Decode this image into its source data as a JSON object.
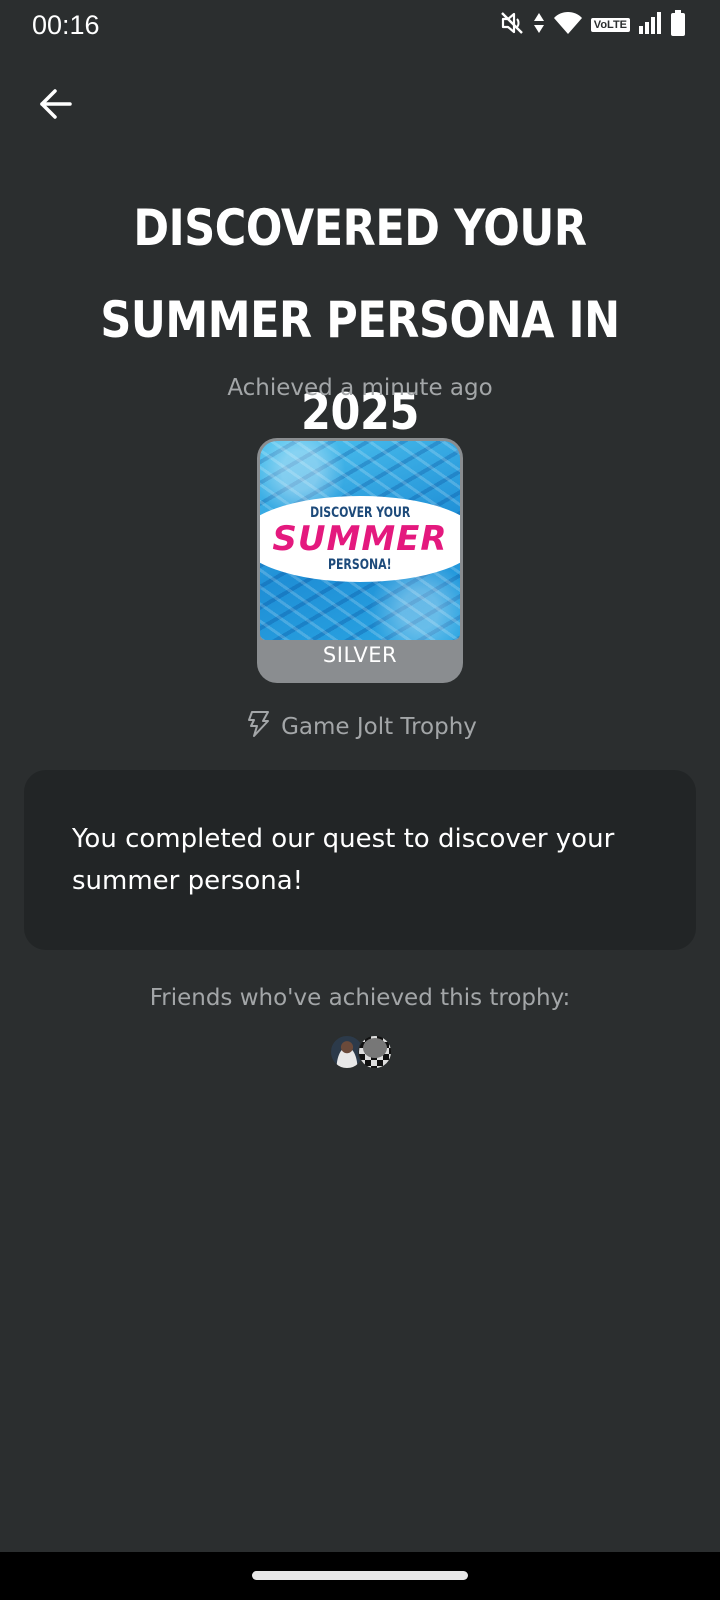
{
  "status_bar": {
    "time": "00:16",
    "volte_label": "VoLTE",
    "icons": [
      "mute-icon",
      "data-arrows-icon",
      "wifi-icon",
      "volte-badge",
      "signal-icon",
      "battery-icon"
    ]
  },
  "header": {
    "back_icon": "arrow-left-icon"
  },
  "trophy": {
    "title": "DISCOVERED YOUR SUMMER PERSONA IN 2025",
    "achieved_time": "Achieved a minute ago",
    "image_text_top": "DISCOVER YOUR",
    "image_text_main": "SUMMER",
    "image_text_bottom": "PERSONA!",
    "tier": "SILVER",
    "source_icon": "game-jolt-bolt-icon",
    "source": "Game Jolt Trophy",
    "description": "You completed our quest to discover your summer persona!"
  },
  "friends": {
    "label": "Friends who've achieved this trophy:",
    "avatars": [
      "friend-avatar-1",
      "friend-avatar-2"
    ]
  },
  "colors": {
    "background": "#2b2e2f",
    "card": "#222526",
    "muted_text": "#a3a6a8",
    "tier_silver": "#8a8d90",
    "summer_pink": "#e4197e",
    "pool_blue": "#2aa6e3"
  }
}
